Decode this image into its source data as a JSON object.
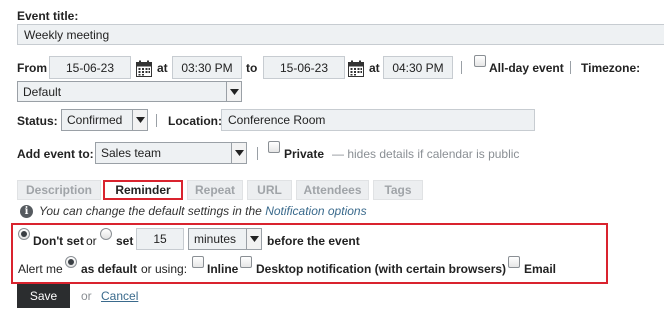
{
  "event_title": {
    "label": "Event title:",
    "value": "Weekly meeting"
  },
  "from": {
    "label": "From",
    "start_date": "15-06-23",
    "at1": "at",
    "start_time": "03:30 PM",
    "to": "to",
    "end_date": "15-06-23",
    "at2": "at",
    "end_time": "04:30 PM"
  },
  "all_day": {
    "label": "All-day event",
    "checked": false
  },
  "timezone": {
    "label": "Timezone:",
    "value": "Default"
  },
  "status": {
    "label": "Status:",
    "value": "Confirmed"
  },
  "location": {
    "label": "Location:",
    "value": "Conference Room"
  },
  "add_event_to": {
    "label": "Add event to:",
    "value": "Sales team"
  },
  "private": {
    "label": "Private",
    "note": "— hides details if calendar is public",
    "checked": false
  },
  "tabs": [
    {
      "label": "Description",
      "active": false
    },
    {
      "label": "Reminder",
      "active": true
    },
    {
      "label": "Repeat",
      "active": false
    },
    {
      "label": "URL",
      "active": false
    },
    {
      "label": "Attendees",
      "active": false
    },
    {
      "label": "Tags",
      "active": false
    }
  ],
  "info": {
    "text": "You can change the default settings in the",
    "link": "Notification options"
  },
  "reminder": {
    "dont_set": "Don't set",
    "or": "or",
    "set": "set",
    "amount": "15",
    "unit": "minutes",
    "before": "before the event",
    "alert_me": "Alert me",
    "as_default": "as default",
    "or_using": "or using:",
    "inline": "Inline",
    "desktop": "Desktop notification (with certain browsers)",
    "email": "Email"
  },
  "actions": {
    "save": "Save",
    "or": "or",
    "cancel": "Cancel"
  },
  "colors": {
    "accent_red": "#d9232e",
    "link_blue": "#3a6a8c",
    "field_bg": "#eef1f3",
    "save_bg": "#2b2d2f"
  }
}
